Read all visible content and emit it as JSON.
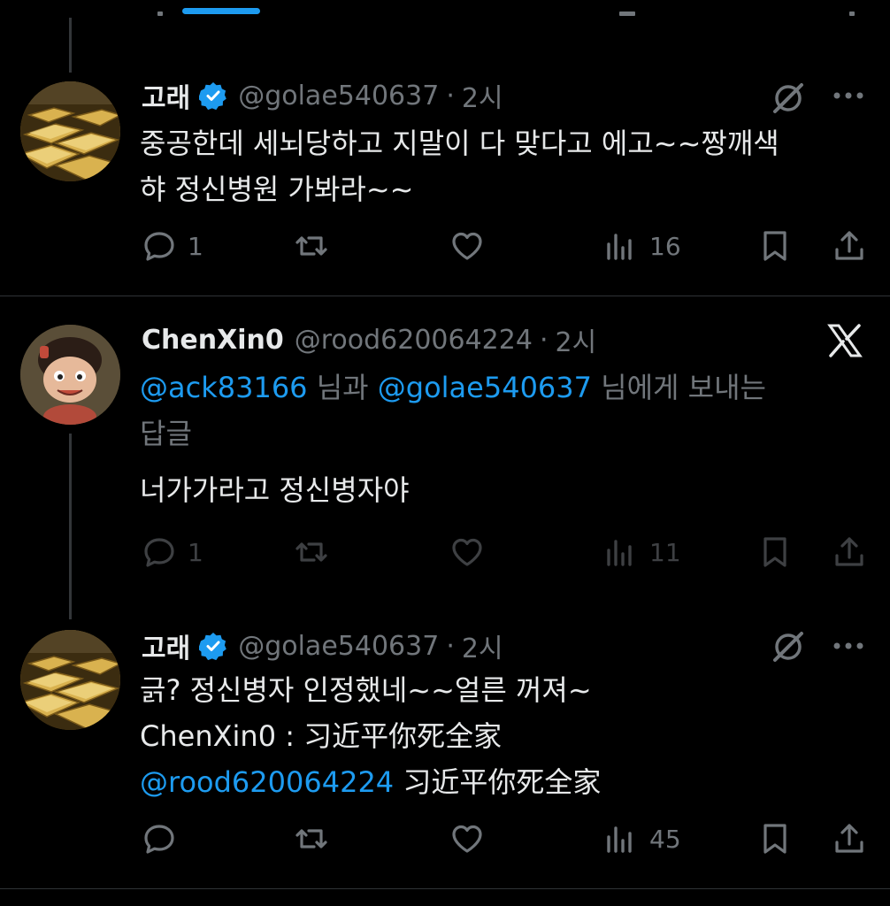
{
  "tweets": [
    {
      "name": "고래",
      "handle": "@golae540637",
      "sep": "·",
      "time": "2시",
      "verified": true,
      "text_lines": [
        "중공한데 세뇌당하고 지말이 다 맞다고 에고~~짱깨색",
        "햐 정신병원 가봐라~~"
      ],
      "replies": "1",
      "retweets": "",
      "likes": "",
      "views": "16"
    },
    {
      "name": "ChenXin0",
      "handle": "@rood620064224",
      "sep": "·",
      "time": "2시",
      "verified": false,
      "reply_to_mention1": "@ack83166",
      "reply_to_mid": " 님과 ",
      "reply_to_mention2": "@golae540637",
      "reply_to_tail1": " 님에게 보내는",
      "reply_to_tail2": "답글",
      "text_lines": [
        "너가가라고 정신병자야"
      ],
      "replies": "1",
      "retweets": "",
      "likes": "",
      "views": "11"
    },
    {
      "name": "고래",
      "handle": "@golae540637",
      "sep": "·",
      "time": "2시",
      "verified": true,
      "text_line1": "긁? 정신병자 인정했네~~얼른 꺼져~",
      "text_line2": "ChenXin0 : 习近平你死全家",
      "text_line3_mention": "@rood620064224",
      "text_line3_tail": " 习近平你死全家",
      "replies": "",
      "retweets": "",
      "likes": "",
      "views": "45"
    }
  ],
  "icons": {
    "reply": "reply-icon",
    "retweet": "retweet-icon",
    "like": "heart-icon",
    "views": "views-icon",
    "bookmark": "bookmark-icon",
    "share": "share-icon",
    "grok": "grok-icon",
    "more": "more-icon",
    "x": "x-logo-icon"
  },
  "colors": {
    "background": "#000000",
    "text": "#e7e9ea",
    "secondary": "#71767b",
    "accent": "#1d9bf0",
    "verified": "#1d9bf0"
  }
}
